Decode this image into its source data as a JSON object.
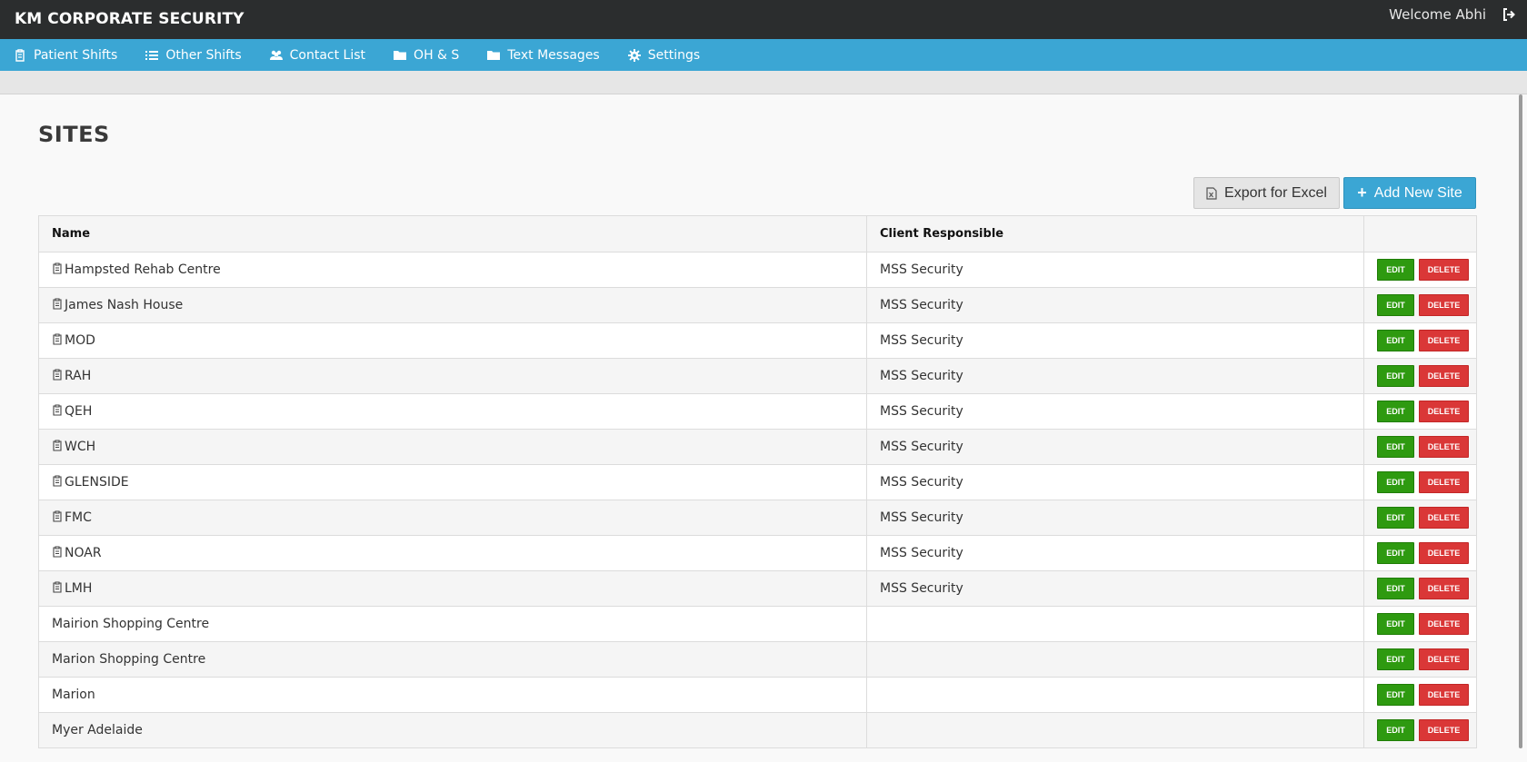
{
  "header": {
    "brand": "KM CORPORATE SECURITY",
    "welcome": "Welcome Abhi"
  },
  "nav": [
    {
      "label": "Patient Shifts",
      "icon": "clipboard-icon"
    },
    {
      "label": "Other Shifts",
      "icon": "list-icon"
    },
    {
      "label": "Contact List",
      "icon": "users-icon"
    },
    {
      "label": "OH & S",
      "icon": "folder-icon"
    },
    {
      "label": "Text Messages",
      "icon": "folder-icon"
    },
    {
      "label": "Settings",
      "icon": "gear-icon"
    }
  ],
  "page": {
    "title": "SITES",
    "export_label": "Export for Excel",
    "add_label": "Add New Site"
  },
  "table": {
    "columns": [
      "Name",
      "Client Responsible",
      ""
    ],
    "edit_label": "EDIT",
    "delete_label": "DELETE",
    "rows": [
      {
        "name": "Hampsted Rehab Centre",
        "client": "MSS Security",
        "icon": true
      },
      {
        "name": "James Nash House",
        "client": "MSS Security",
        "icon": true
      },
      {
        "name": "MOD",
        "client": "MSS Security",
        "icon": true
      },
      {
        "name": "RAH",
        "client": "MSS Security",
        "icon": true
      },
      {
        "name": "QEH",
        "client": "MSS Security",
        "icon": true
      },
      {
        "name": "WCH",
        "client": "MSS Security",
        "icon": true
      },
      {
        "name": "GLENSIDE",
        "client": "MSS Security",
        "icon": true
      },
      {
        "name": "FMC",
        "client": "MSS Security",
        "icon": true
      },
      {
        "name": "NOAR",
        "client": "MSS Security",
        "icon": true
      },
      {
        "name": "LMH",
        "client": "MSS Security",
        "icon": true
      },
      {
        "name": "Mairion Shopping Centre",
        "client": "",
        "icon": false
      },
      {
        "name": "Marion Shopping Centre",
        "client": "",
        "icon": false
      },
      {
        "name": "Marion",
        "client": "",
        "icon": false
      },
      {
        "name": "Myer Adelaide",
        "client": "",
        "icon": false
      }
    ]
  }
}
